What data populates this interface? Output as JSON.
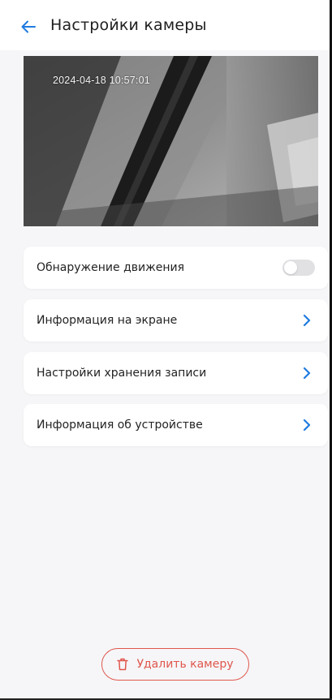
{
  "header": {
    "back_icon": "arrow-left-icon",
    "title": "Настройки камеры"
  },
  "preview": {
    "timestamp": "2024-04-18 10:57:01"
  },
  "settings": {
    "motion_detection": {
      "label": "Обнаружение движения",
      "enabled": false
    },
    "items": [
      {
        "label": "Информация на экране",
        "icon": "chevron-right-icon"
      },
      {
        "label": "Настройки хранения записи",
        "icon": "chevron-right-icon"
      },
      {
        "label": "Информация об устройстве",
        "icon": "chevron-right-icon"
      }
    ]
  },
  "footer": {
    "delete_icon": "trash-icon",
    "delete_label": "Удалить камеру"
  },
  "colors": {
    "accent": "#1f7be0",
    "danger": "#e0564d",
    "background": "#f6f6f8",
    "card": "#ffffff"
  }
}
